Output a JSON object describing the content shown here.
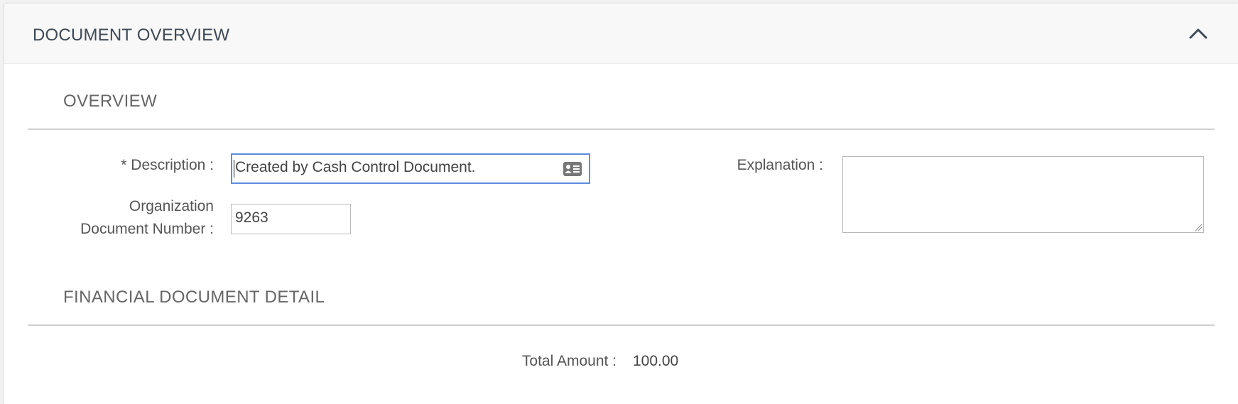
{
  "header": {
    "title": "DOCUMENT OVERVIEW",
    "collapse_icon": "chevron-up-icon"
  },
  "overview": {
    "title": "OVERVIEW",
    "description": {
      "required_marker": "*",
      "label": "Description :",
      "value": "Created by Cash Control Document.",
      "icon": "contact-card-icon"
    },
    "org_doc_number": {
      "label_line1": "Organization",
      "label_line2": "Document Number :",
      "value": "9263"
    },
    "explanation": {
      "label": "Explanation :",
      "value": ""
    }
  },
  "financial": {
    "title": "FINANCIAL DOCUMENT DETAIL",
    "total_amount": {
      "label": "Total Amount :",
      "value": "100.00"
    }
  },
  "colors": {
    "focus_border": "#5b8dde",
    "header_text": "#3f4a56"
  }
}
